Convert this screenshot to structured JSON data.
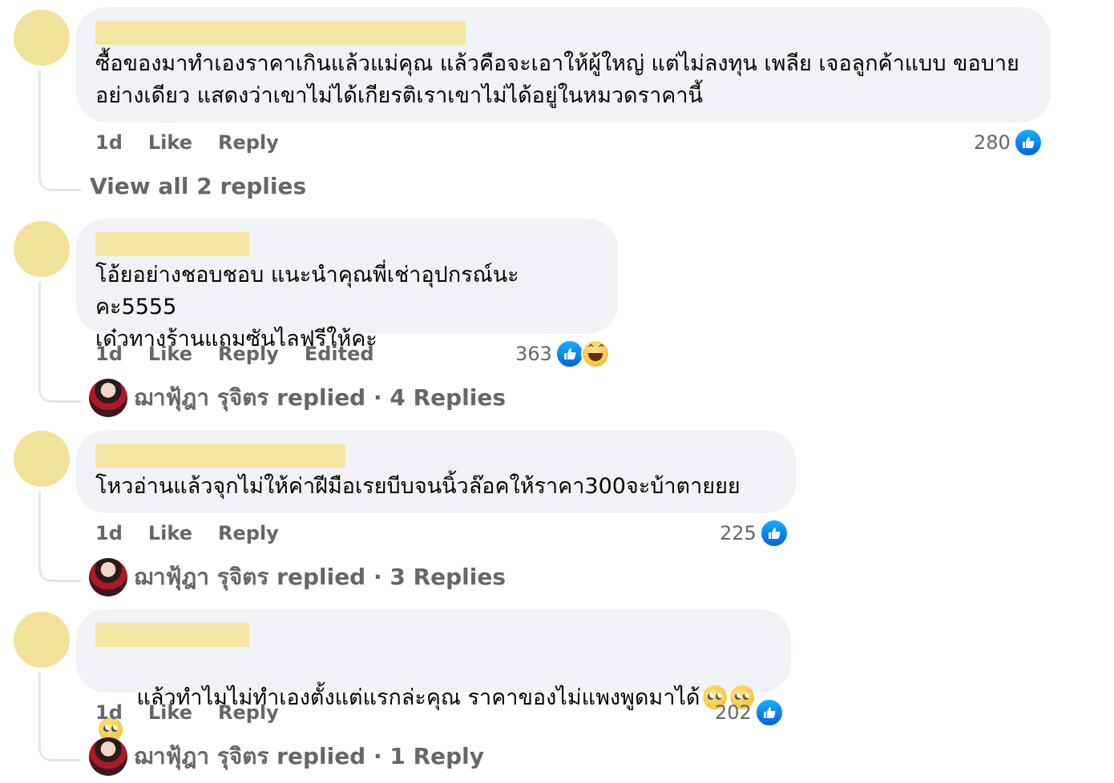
{
  "comments": [
    {
      "text": "ซื้อของมาทำเองราคาเกินแล้วแม่คุณ แล้วคือจะเอาให้ผู้ใหญ่ แต่ไม่ลงทุน เพลีย เจอลูกค้าแบบ ขอบายอย่างเดียว แสดงว่าเขาไม่ได้เกียรติเราเขาไม่ได้อยู่ในหมวดราคานี้",
      "time": "1d",
      "like_label": "Like",
      "reply_label": "Reply",
      "edited_label": "",
      "reaction_count": "280",
      "reactions": [
        "like-icon"
      ],
      "thread_text": "View all 2 replies"
    },
    {
      "text": "โอ้ยอย่างชอบชอบ แนะนำคุณพี่เช่าอุปกรณ์นะคะ5555\nเด๋วทางร้านแถมซันไลฟรีให้คะ",
      "time": "1d",
      "like_label": "Like",
      "reply_label": "Reply",
      "edited_label": "Edited",
      "reaction_count": "363",
      "reactions": [
        "like-icon",
        "haha-icon"
      ],
      "thread_text": "ฌาฟุ้ฎา รุจิตร replied · 4 Replies"
    },
    {
      "text": "โหวอ่านแล้วจุกไม่ให้ค่าฝีมือเรยบีบจนนิ้วล๊อคให้ราคา300จะบ้าตายยย",
      "time": "1d",
      "like_label": "Like",
      "reply_label": "Reply",
      "edited_label": "",
      "reaction_count": "225",
      "reactions": [
        "like-icon"
      ],
      "thread_text": "ฌาฟุ้ฎา รุจิตร replied · 3 Replies"
    },
    {
      "text": "แล้วทำไมไม่ทำเองตั้งแต่แรกล่ะคุณ ราคาของไม่แพงพูดมาได้",
      "emojis": [
        "eye-roll-emoji",
        "eye-roll-emoji",
        "eye-roll-emoji"
      ],
      "time": "1d",
      "like_label": "Like",
      "reply_label": "Reply",
      "edited_label": "",
      "reaction_count": "202",
      "reactions": [
        "like-icon"
      ],
      "thread_text": "ฌาฟุ้ฎา รุจิตร replied · 1 Reply"
    }
  ],
  "colors": {
    "bubble_bg": "#f0f2f5",
    "redaction": "#f5e6a3",
    "avatar_placeholder": "#f2e199",
    "secondary_text": "#65676b",
    "like_blue": "#0866ff"
  }
}
